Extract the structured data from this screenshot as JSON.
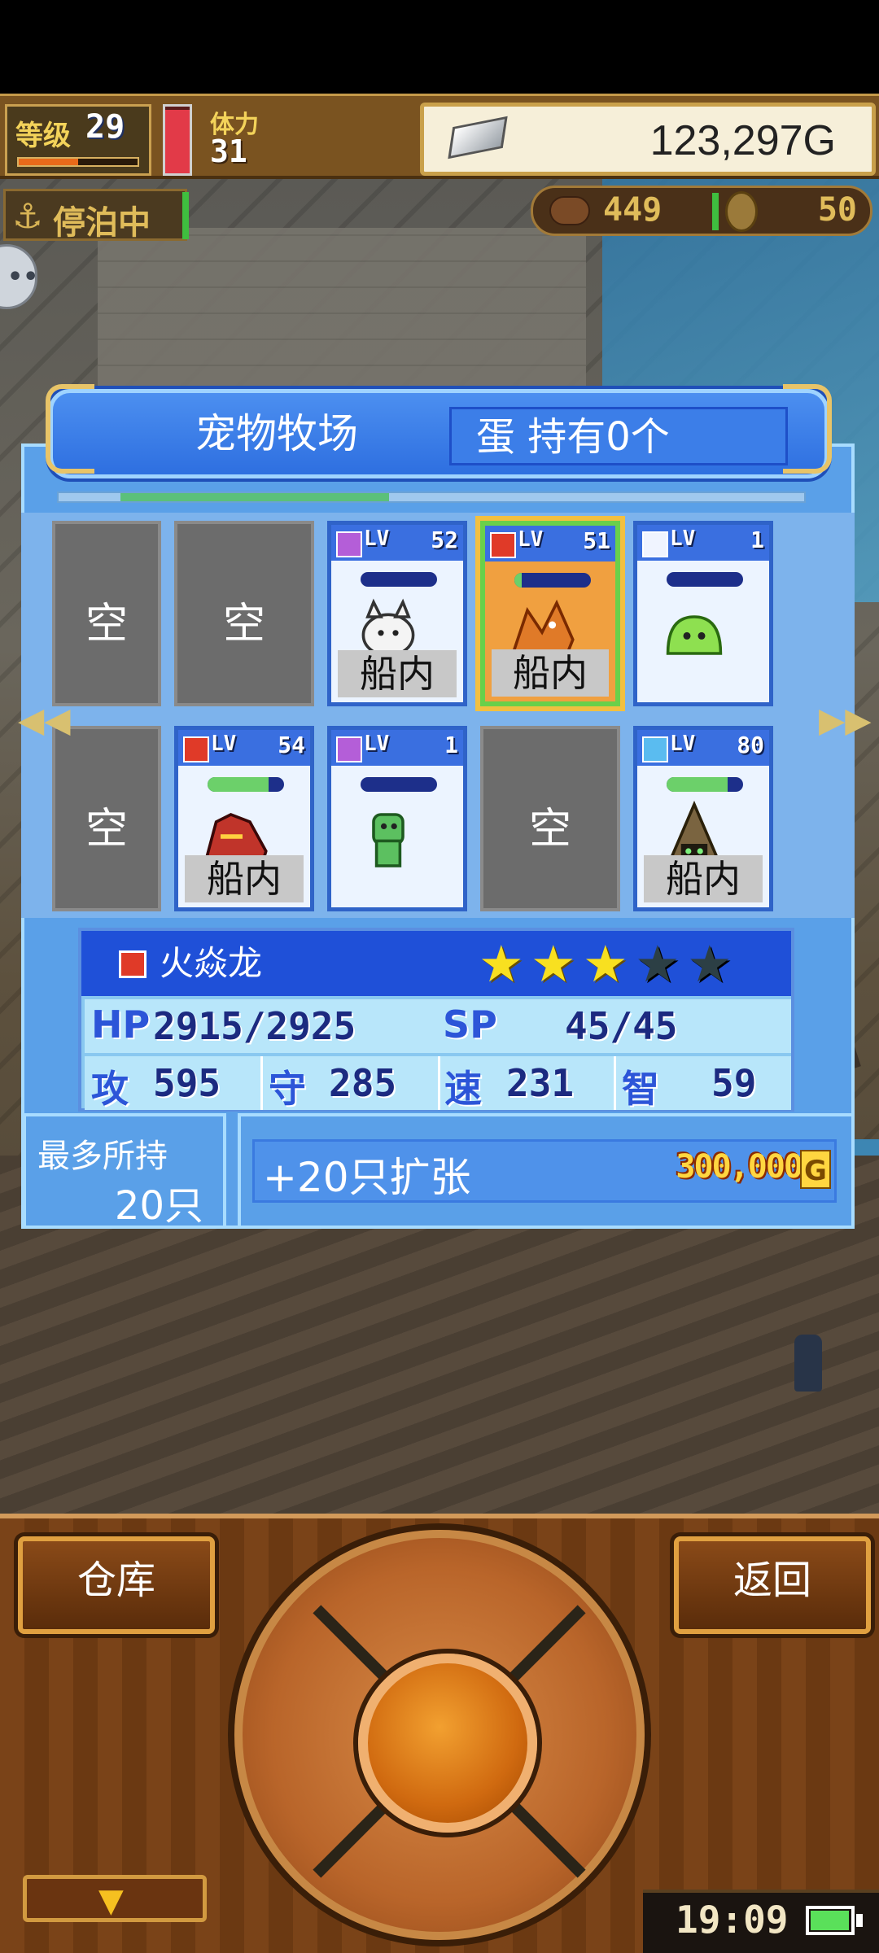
{
  "hud": {
    "level_label": "等级",
    "level_value": "29",
    "exp_fraction": 0.5,
    "stamina_label": "体力",
    "stamina_value": "31",
    "stamina_fraction": 0.95,
    "gold": "123,297G",
    "docked_label": "停泊中",
    "resource_a": "449",
    "resource_b": "50"
  },
  "panel": {
    "title": "宠物牧场",
    "egg_text": "蛋 持有0个",
    "scroll_fraction": 0.36
  },
  "slots": {
    "empty_label": "空",
    "ship_label": "船内",
    "lv_label": "LV",
    "row1": [
      {
        "state": "empty"
      },
      {
        "state": "empty"
      },
      {
        "state": "pet",
        "element": "magic",
        "level": "52",
        "hp": 0.0,
        "ship": true,
        "sprite": "white-wolf-sprite"
      },
      {
        "state": "pet",
        "element": "fire",
        "level": "51",
        "hp": 0.1,
        "ship": true,
        "selected": true,
        "sprite": "fire-dragon-sprite"
      },
      {
        "state": "pet",
        "element": "light",
        "level": "1",
        "hp": 0.0,
        "ship": false,
        "sprite": "green-slime-sprite"
      }
    ],
    "row2": [
      {
        "state": "empty"
      },
      {
        "state": "pet",
        "element": "fire",
        "level": "54",
        "hp": 0.8,
        "ship": true,
        "sprite": "red-dragon-sprite"
      },
      {
        "state": "pet",
        "element": "magic",
        "level": "1",
        "hp": 0.0,
        "ship": false,
        "sprite": "green-lizard-sprite"
      },
      {
        "state": "empty"
      },
      {
        "state": "pet",
        "element": "water",
        "level": "80",
        "hp": 0.8,
        "ship": true,
        "sprite": "hooded-mage-sprite"
      }
    ]
  },
  "info": {
    "element": "fire",
    "name": "火焱龙",
    "stars": 3,
    "max_stars": 5,
    "hp_label": "HP",
    "hp_value": "2915/2925",
    "sp_label": "SP",
    "sp_value": "45/45",
    "atk_label": "攻",
    "atk_value": "595",
    "def_label": "守",
    "def_value": "285",
    "spd_label": "速",
    "spd_value": "231",
    "int_label": "智",
    "int_value": "59"
  },
  "capacity": {
    "label": "最多所持",
    "value": "20只"
  },
  "expand": {
    "label": "+20只扩张",
    "price": "300,000",
    "currency_symbol": "G"
  },
  "controls": {
    "warehouse": "仓库",
    "back": "返回"
  },
  "status": {
    "clock": "19:09",
    "battery_fraction": 0.9
  },
  "colors": {
    "panel_blue": "#5aa0e8",
    "header_blue": "#2e6fe0",
    "wood": "#7a4318",
    "star_on": "#f8e020"
  }
}
